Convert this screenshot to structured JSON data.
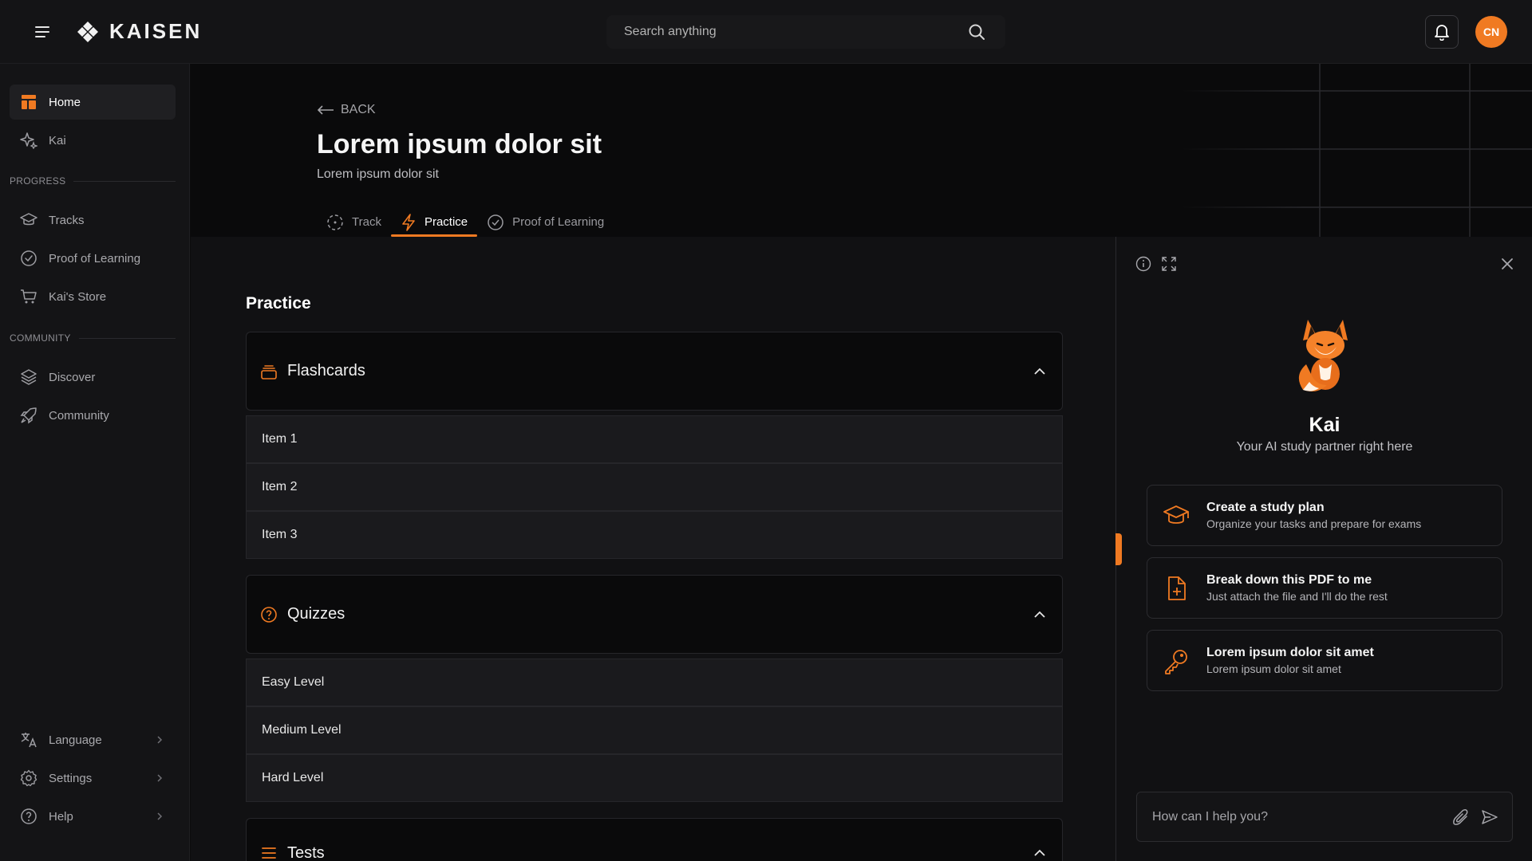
{
  "brand": {
    "name": "KAISEN",
    "accent": "#f07a22"
  },
  "header": {
    "search_placeholder": "Search anything",
    "avatar_initials": "CN"
  },
  "sidebar": {
    "items_top": [
      {
        "label": "Home",
        "icon": "home-icon",
        "active": true
      },
      {
        "label": "Kai",
        "icon": "sparkle-icon"
      }
    ],
    "progress_label": "PROGRESS",
    "progress_items": [
      {
        "label": "Tracks",
        "icon": "graduation-cap-icon"
      },
      {
        "label": "Proof of Learning",
        "icon": "check-circle-icon"
      },
      {
        "label": "Kai's Store",
        "icon": "cart-icon"
      }
    ],
    "community_label": "COMMUNITY",
    "community_items": [
      {
        "label": "Discover",
        "icon": "layers-icon"
      },
      {
        "label": "Community",
        "icon": "rocket-icon"
      }
    ],
    "bottom_items": [
      {
        "label": "Language",
        "icon": "translate-icon"
      },
      {
        "label": "Settings",
        "icon": "gear-icon"
      },
      {
        "label": "Help",
        "icon": "help-circle-icon"
      }
    ]
  },
  "hero": {
    "back_label": "BACK",
    "title": "Lorem ipsum dolor sit",
    "subtitle": "Lorem ipsum dolor sit",
    "tabs": [
      {
        "label": "Track",
        "icon": "dashed-circle-icon"
      },
      {
        "label": "Practice",
        "icon": "lightning-icon",
        "active": true
      },
      {
        "label": "Proof of Learning",
        "icon": "check-circle-icon"
      }
    ]
  },
  "main": {
    "section_title": "Practice",
    "accordions": [
      {
        "title": "Flashcards",
        "icon": "cards-icon",
        "items": [
          "Item 1",
          "Item 2",
          "Item 3"
        ]
      },
      {
        "title": "Quizzes",
        "icon": "question-circle-icon",
        "items": [
          "Easy Level",
          "Medium Level",
          "Hard Level"
        ]
      },
      {
        "title": "Tests",
        "icon": "list-icon",
        "items": []
      }
    ]
  },
  "assistant": {
    "name": "Kai",
    "tagline": "Your AI study partner right here",
    "suggestions": [
      {
        "title": "Create a study plan",
        "subtitle": "Organize your tasks and prepare for exams",
        "icon": "graduation-cap-icon"
      },
      {
        "title": "Break down this PDF to me",
        "subtitle": "Just attach the file and I'll do the rest",
        "icon": "file-plus-icon"
      },
      {
        "title": "Lorem ipsum dolor sit amet",
        "subtitle": "Lorem ipsum dolor sit amet",
        "icon": "key-icon"
      }
    ],
    "input_placeholder": "How can I help you?"
  }
}
